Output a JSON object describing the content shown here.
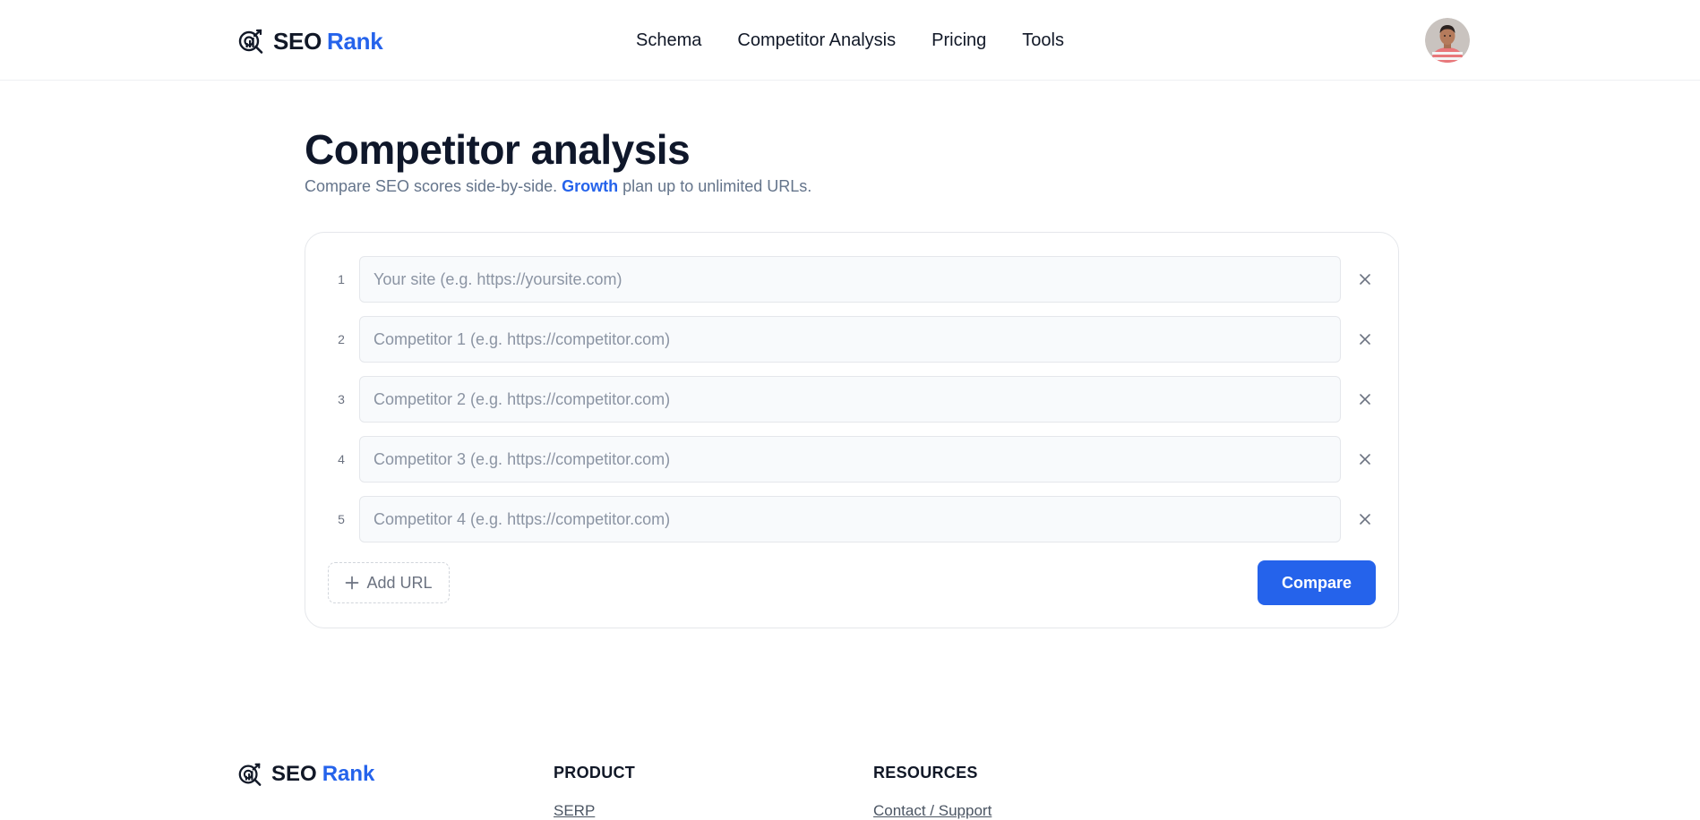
{
  "header": {
    "brand": {
      "part1": "SEO",
      "part2": "Rank"
    },
    "nav": [
      "Schema",
      "Competitor Analysis",
      "Pricing",
      "Tools"
    ],
    "avatar_icon": "user-avatar"
  },
  "main": {
    "title": "Competitor analysis",
    "subtitle_before": "Compare SEO scores side-by-side.",
    "subtitle_link": "Growth",
    "subtitle_after": "plan up to unlimited URLs.",
    "url_rows": [
      {
        "number": "1",
        "value": "",
        "placeholder": "Your site (e.g. https://yoursite.com)"
      },
      {
        "number": "2",
        "value": "",
        "placeholder": "Competitor 1 (e.g. https://competitor.com)"
      },
      {
        "number": "3",
        "value": "",
        "placeholder": "Competitor 2 (e.g. https://competitor.com)"
      },
      {
        "number": "4",
        "value": "",
        "placeholder": "Competitor 3 (e.g. https://competitor.com)"
      },
      {
        "number": "5",
        "value": "",
        "placeholder": "Competitor 4 (e.g. https://competitor.com)"
      }
    ],
    "add_url_label": "Add URL",
    "compare_label": "Compare"
  },
  "footer": {
    "brand": {
      "part1": "SEO",
      "part2": "Rank"
    },
    "columns": [
      {
        "heading": "PRODUCT",
        "first_link": "SERP"
      },
      {
        "heading": "RESOURCES",
        "first_link": "Contact / Support"
      }
    ]
  },
  "colors": {
    "accent": "#2563eb",
    "title": "#0f172a",
    "muted": "#64748b",
    "border": "#e5e7eb"
  }
}
